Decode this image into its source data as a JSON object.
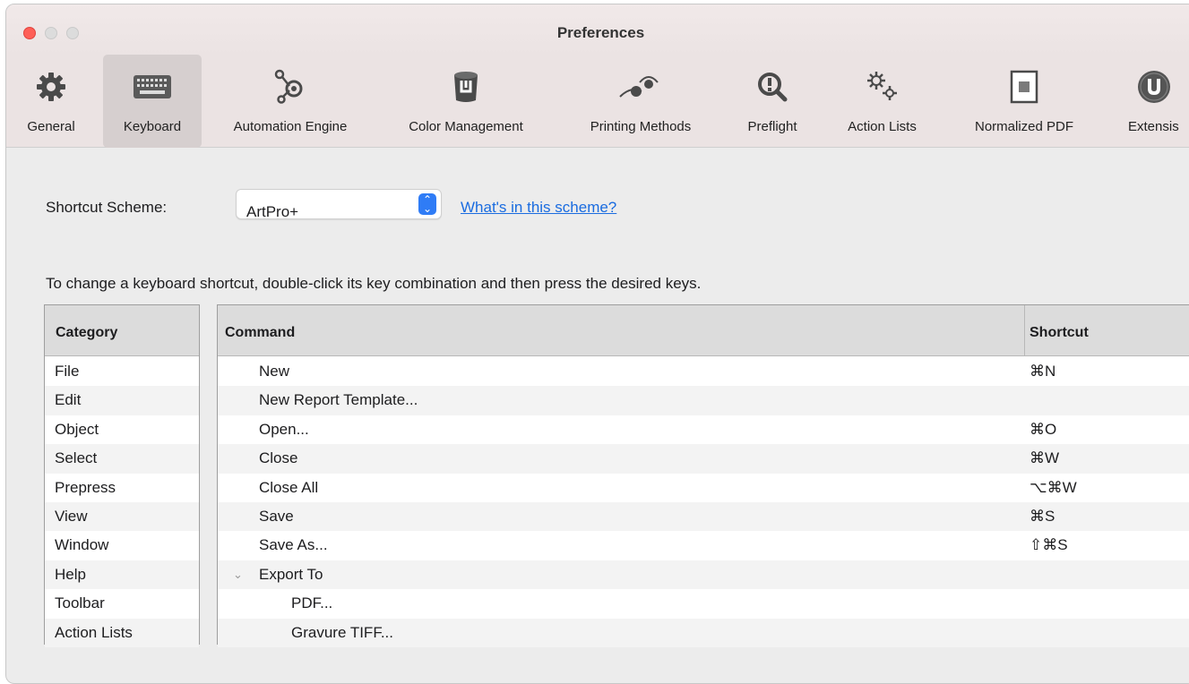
{
  "window": {
    "title": "Preferences"
  },
  "toolbar": {
    "items": [
      {
        "label": "General",
        "icon": "gear-icon",
        "selected": false
      },
      {
        "label": "Keyboard",
        "icon": "keyboard-icon",
        "selected": true
      },
      {
        "label": "Automation Engine",
        "icon": "automation-engine-icon",
        "selected": false
      },
      {
        "label": "Color Management",
        "icon": "color-management-icon",
        "selected": false
      },
      {
        "label": "Printing Methods",
        "icon": "printing-methods-icon",
        "selected": false
      },
      {
        "label": "Preflight",
        "icon": "preflight-icon",
        "selected": false
      },
      {
        "label": "Action Lists",
        "icon": "action-lists-icon",
        "selected": false
      },
      {
        "label": "Normalized PDF",
        "icon": "normalized-pdf-icon",
        "selected": false
      },
      {
        "label": "Extensis",
        "icon": "extensis-icon",
        "selected": false
      }
    ]
  },
  "scheme": {
    "label": "Shortcut Scheme:",
    "value": "ArtPro+",
    "link": "What's in this scheme?"
  },
  "instructions": "To change a keyboard shortcut, double-click its key combination and then press the desired keys.",
  "category_table": {
    "header": "Category",
    "rows": [
      "File",
      "Edit",
      "Object",
      "Select",
      "Prepress",
      "View",
      "Window",
      "Help",
      "Toolbar",
      "Action Lists"
    ]
  },
  "command_table": {
    "headers": {
      "command": "Command",
      "shortcut": "Shortcut"
    },
    "rows": [
      {
        "command": "New",
        "shortcut": "⌘N",
        "indent": 0,
        "disclosure": ""
      },
      {
        "command": "New Report Template...",
        "shortcut": "",
        "indent": 0,
        "disclosure": ""
      },
      {
        "command": "Open...",
        "shortcut": "⌘O",
        "indent": 0,
        "disclosure": ""
      },
      {
        "command": "Close",
        "shortcut": "⌘W",
        "indent": 0,
        "disclosure": ""
      },
      {
        "command": "Close All",
        "shortcut": "⌥⌘W",
        "indent": 0,
        "disclosure": ""
      },
      {
        "command": "Save",
        "shortcut": "⌘S",
        "indent": 0,
        "disclosure": ""
      },
      {
        "command": "Save As...",
        "shortcut": "⇧⌘S",
        "indent": 0,
        "disclosure": ""
      },
      {
        "command": "Export To",
        "shortcut": "",
        "indent": 0,
        "disclosure": "⌄"
      },
      {
        "command": "PDF...",
        "shortcut": "",
        "indent": 1,
        "disclosure": ""
      },
      {
        "command": "Gravure TIFF...",
        "shortcut": "",
        "indent": 1,
        "disclosure": ""
      }
    ]
  },
  "colors": {
    "accent": "#2f7cf6",
    "link": "#1a6ce0",
    "close": "#fe5f57"
  }
}
